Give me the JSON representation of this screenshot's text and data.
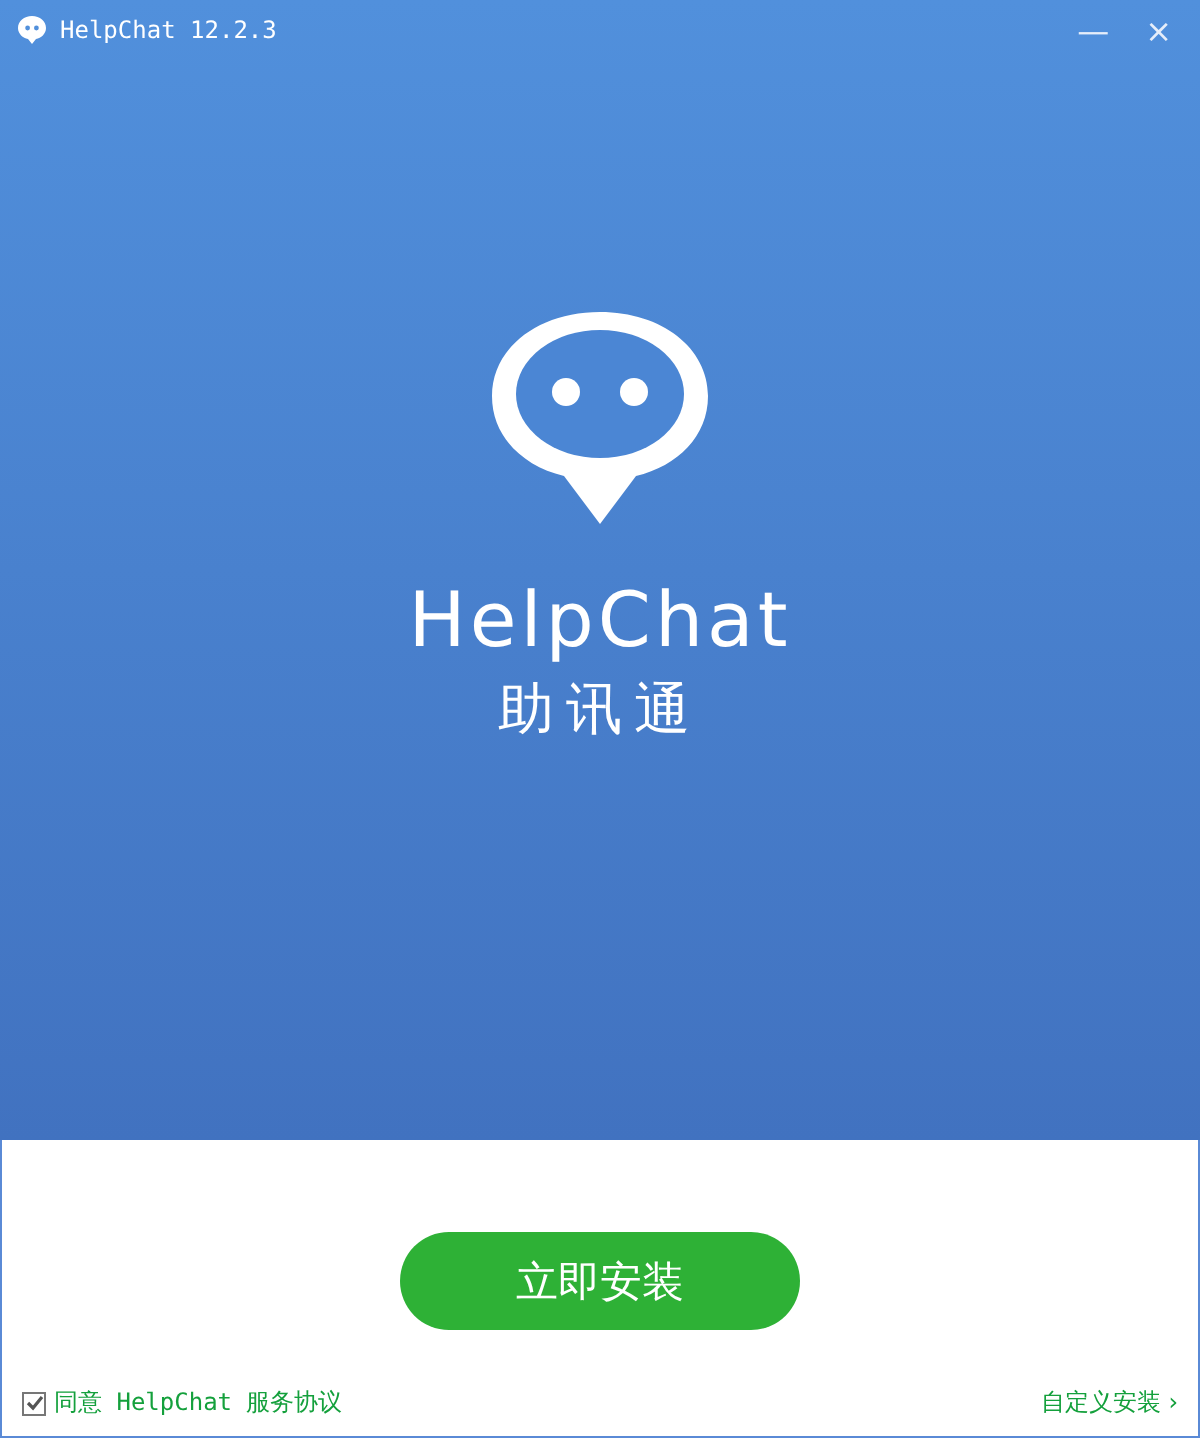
{
  "window": {
    "title": "HelpChat 12.2.3",
    "minimize": "—",
    "close": "×"
  },
  "brand": {
    "name": "HelpChat",
    "subtitle": "助讯通"
  },
  "install_button": "立即安装",
  "agreement": {
    "checked": true,
    "label": "同意 HelpChat 服务协议"
  },
  "custom_install": {
    "label": "自定义安装",
    "chevron": "›"
  }
}
